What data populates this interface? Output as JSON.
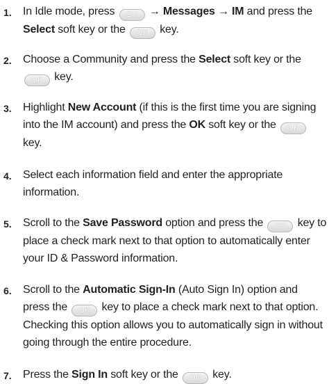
{
  "key_label": "OK",
  "arrow": "→",
  "steps": [
    {
      "num": "1.",
      "parts": [
        "In Idle mode, press",
        "→ Messages → IM",
        "and press the",
        "Select",
        "soft key or the",
        "key."
      ]
    },
    {
      "num": "2.",
      "parts": [
        "Choose a Community and press the",
        "Select",
        "soft key or the",
        "key."
      ]
    },
    {
      "num": "3.",
      "parts": [
        "Highlight",
        "New Account",
        "(if this is the first time you are signing into the IM account) and press the",
        "OK",
        "soft key or the",
        "key."
      ]
    },
    {
      "num": "4.",
      "parts": [
        "Select each information field and enter the appropriate information."
      ]
    },
    {
      "num": "5.",
      "parts": [
        "Scroll to the",
        "Save Password",
        "option and press the",
        "key to place a check mark next to that option to automatically enter your ID & Password information."
      ]
    },
    {
      "num": "6.",
      "parts": [
        "Scroll to the",
        "Automatic Sign-In",
        "(Auto Sign In) option and press the",
        "key to place a check mark next to that option. Checking this option allows you to automatically sign in without going through the entire procedure."
      ]
    },
    {
      "num": "7.",
      "parts": [
        "Press the",
        "Sign In",
        "soft key or the",
        "key."
      ]
    }
  ]
}
